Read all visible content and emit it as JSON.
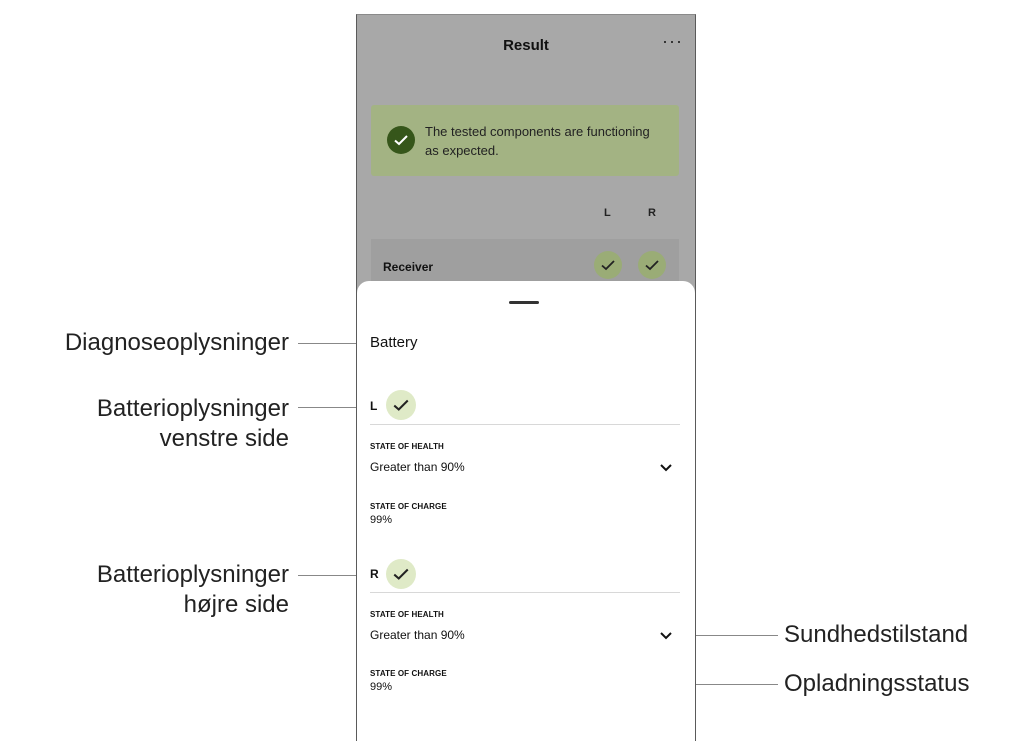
{
  "header": {
    "title": "Result",
    "more_icon": "more-horizontal-icon",
    "more_glyph": "···"
  },
  "banner": {
    "icon": "check-circle-icon",
    "text": "The tested components are functioning as expected.",
    "color": "#a3b383"
  },
  "columns": {
    "left": "L",
    "right": "R"
  },
  "components": [
    {
      "label": "Receiver",
      "left_ok": true,
      "right_ok": true
    }
  ],
  "sheet": {
    "title": "Battery",
    "left": {
      "side": "L",
      "health_label": "STATE OF HEALTH",
      "health_value": "Greater than 90%",
      "charge_label": "STATE OF CHARGE",
      "charge_value": "99%"
    },
    "right": {
      "side": "R",
      "health_label": "STATE OF HEALTH",
      "health_value": "Greater than 90%",
      "charge_label": "STATE OF CHARGE",
      "charge_value": "99%"
    }
  },
  "callouts": {
    "diagnose": "Diagnoseoplysninger",
    "left_line1": "Batterioplysninger",
    "left_line2": "venstre side",
    "right_line1": "Batterioplysninger",
    "right_line2": "højre side",
    "health": "Sundhedstilstand",
    "charge": "Opladningsstatus"
  },
  "colors": {
    "accent_green": "#36561a",
    "light_green": "#dfeac7",
    "overlay_gray": "#a8a8a8"
  }
}
